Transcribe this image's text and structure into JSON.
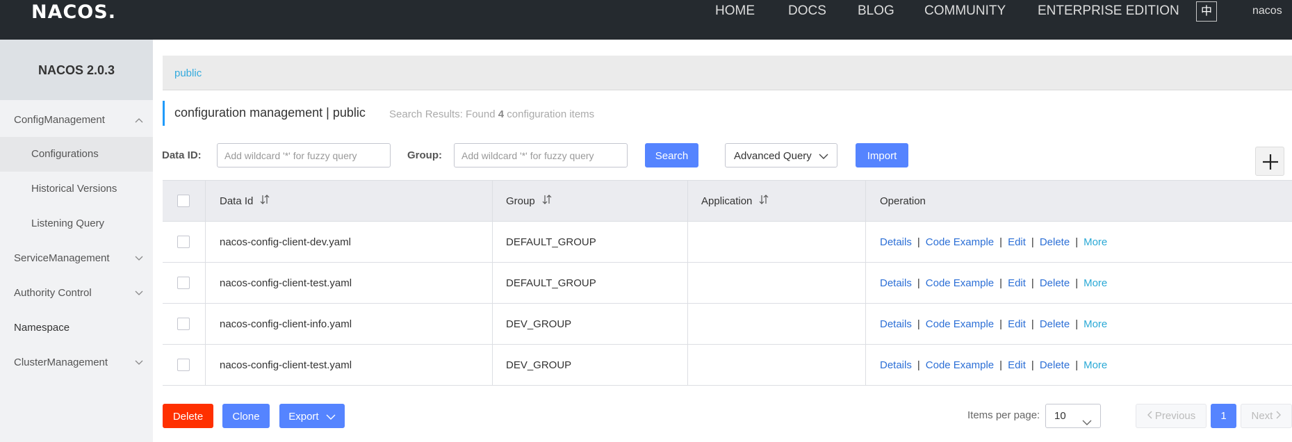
{
  "topnav": {
    "logo": "NACOS.",
    "items": [
      "HOME",
      "DOCS",
      "BLOG",
      "COMMUNITY",
      "ENTERPRISE EDITION"
    ],
    "lang": "中",
    "user": "nacos"
  },
  "sidebar": {
    "title": "NACOS 2.0.3",
    "config": "ConfigManagement",
    "config_sub": [
      "Configurations",
      "Historical Versions",
      "Listening Query"
    ],
    "service": "ServiceManagement",
    "authority": "Authority Control",
    "namespace": "Namespace",
    "cluster": "ClusterManagement"
  },
  "breadcrumb": {
    "namespace": "public"
  },
  "page": {
    "title": "configuration management  |  public",
    "result_prefix": "Search Results: Found",
    "result_count": "4",
    "result_suffix": "configuration items"
  },
  "search": {
    "data_id_label": "Data ID:",
    "data_id_placeholder": "Add wildcard '*' for fuzzy query",
    "group_label": "Group:",
    "group_placeholder": "Add wildcard '*' for fuzzy query",
    "search_btn": "Search",
    "advanced_btn": "Advanced Query",
    "import_btn": "Import"
  },
  "table": {
    "headers": {
      "data_id": "Data Id",
      "group": "Group",
      "application": "Application",
      "operation": "Operation"
    },
    "ops": {
      "details": "Details",
      "code": "Code Example",
      "edit": "Edit",
      "delete": "Delete",
      "more": "More",
      "sep": "|"
    },
    "rows": [
      {
        "data_id": "nacos-config-client-dev.yaml",
        "group": "DEFAULT_GROUP",
        "application": ""
      },
      {
        "data_id": "nacos-config-client-test.yaml",
        "group": "DEFAULT_GROUP",
        "application": ""
      },
      {
        "data_id": "nacos-config-client-info.yaml",
        "group": "DEV_GROUP",
        "application": ""
      },
      {
        "data_id": "nacos-config-client-test.yaml",
        "group": "DEV_GROUP",
        "application": ""
      }
    ]
  },
  "footer": {
    "delete_btn": "Delete",
    "clone_btn": "Clone",
    "export_btn": "Export",
    "items_per_page_label": "Items per page:",
    "items_per_page": "10",
    "prev": "Previous",
    "page": "1",
    "next": "Next"
  },
  "colors": {
    "nav_bg": "#252a2f",
    "primary": "#5584ff",
    "danger": "#ff3000",
    "accent": "#209bfa",
    "link": "#2c6fd6"
  }
}
